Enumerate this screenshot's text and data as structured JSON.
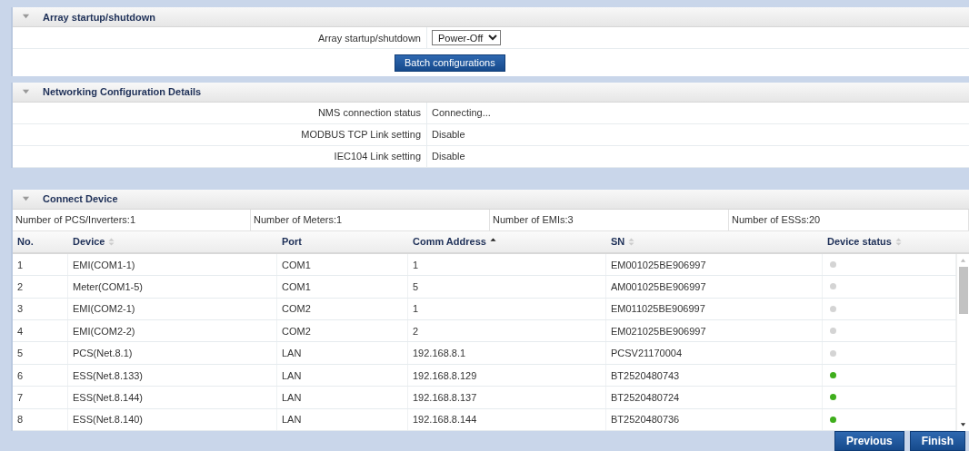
{
  "array_section": {
    "title": "Array startup/shutdown",
    "expanded": true,
    "field_label": "Array startup/shutdown",
    "select_value": "Power-Off",
    "button": "Batch configurations"
  },
  "networking_section": {
    "title": "Networking Configuration Details",
    "expanded": true,
    "rows": [
      {
        "label": "NMS connection status",
        "value": "Connecting..."
      },
      {
        "label": "MODBUS TCP Link setting",
        "value": "Disable"
      },
      {
        "label": "IEC104 Link setting",
        "value": "Disable"
      }
    ]
  },
  "connect_section": {
    "title": "Connect Device",
    "expanded": true,
    "counts": [
      "Number of PCS/Inverters:1",
      "Number of Meters:1",
      "Number of EMIs:3",
      "Number of ESSs:20"
    ],
    "table": {
      "columns": [
        {
          "label": "No.",
          "sortable": false,
          "sorted": false
        },
        {
          "label": "Device",
          "sortable": true,
          "sorted": false
        },
        {
          "label": "Port",
          "sortable": false,
          "sorted": false
        },
        {
          "label": "Comm Address",
          "sortable": true,
          "sorted": true
        },
        {
          "label": "SN",
          "sortable": true,
          "sorted": false
        },
        {
          "label": "Device status",
          "sortable": true,
          "sorted": false
        }
      ],
      "rows": [
        {
          "no": "1",
          "device": "EMI(COM1-1)",
          "port": "COM1",
          "address": "1",
          "sn": "EM001025BE906997",
          "color": "#d4d4d4"
        },
        {
          "no": "2",
          "device": "Meter(COM1-5)",
          "port": "COM1",
          "address": "5",
          "sn": "AM001025BE906997",
          "color": "#d4d4d4"
        },
        {
          "no": "3",
          "device": "EMI(COM2-1)",
          "port": "COM2",
          "address": "1",
          "sn": "EM011025BE906997",
          "color": "#d4d4d4"
        },
        {
          "no": "4",
          "device": "EMI(COM2-2)",
          "port": "COM2",
          "address": "2",
          "sn": "EM021025BE906997",
          "color": "#d4d4d4"
        },
        {
          "no": "5",
          "device": "PCS(Net.8.1)",
          "port": "LAN",
          "address": "192.168.8.1",
          "sn": "PCSV21170004",
          "color": "#d4d4d4"
        },
        {
          "no": "6",
          "device": "ESS(Net.8.133)",
          "port": "LAN",
          "address": "192.168.8.129",
          "sn": "BT2520480743",
          "color": "#3fae1c"
        },
        {
          "no": "7",
          "device": "ESS(Net.8.144)",
          "port": "LAN",
          "address": "192.168.8.137",
          "sn": "BT2520480724",
          "color": "#3fae1c"
        },
        {
          "no": "8",
          "device": "ESS(Net.8.140)",
          "port": "LAN",
          "address": "192.168.8.144",
          "sn": "BT2520480736",
          "color": "#3fae1c"
        }
      ]
    }
  },
  "footer_buttons": [
    "Previous",
    "Finish"
  ]
}
